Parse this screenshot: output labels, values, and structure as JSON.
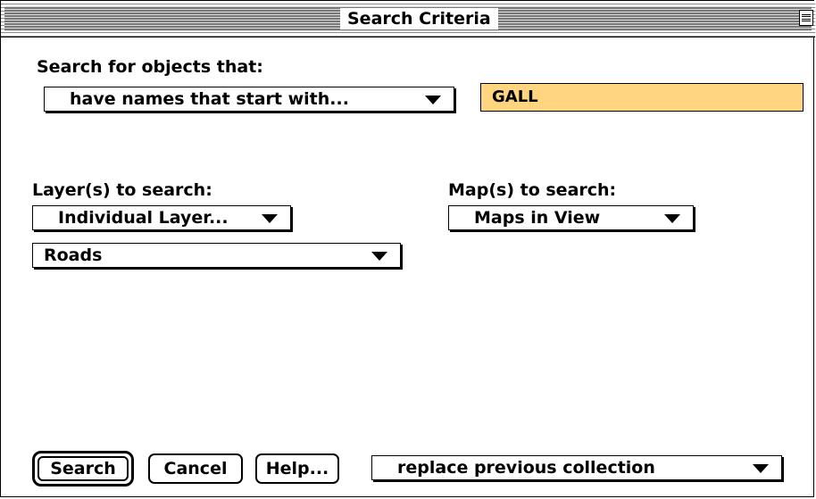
{
  "window": {
    "title": "Search Criteria"
  },
  "criteria": {
    "label": "Search for objects that:",
    "condition_value": "have names that start with...",
    "search_text": "GALL",
    "search_text_bg": "#ffd580"
  },
  "layers": {
    "label": "Layer(s) to search:",
    "mode_value": "Individual Layer...",
    "layer_value": "Roads"
  },
  "maps": {
    "label": "Map(s) to search:",
    "value": "Maps in View"
  },
  "footer": {
    "search_label": "Search",
    "cancel_label": "Cancel",
    "help_label": "Help...",
    "collection_value": "replace previous collection"
  },
  "icons": {
    "dropdown": "chevron-down-icon",
    "collapse": "collapse-box-icon"
  }
}
